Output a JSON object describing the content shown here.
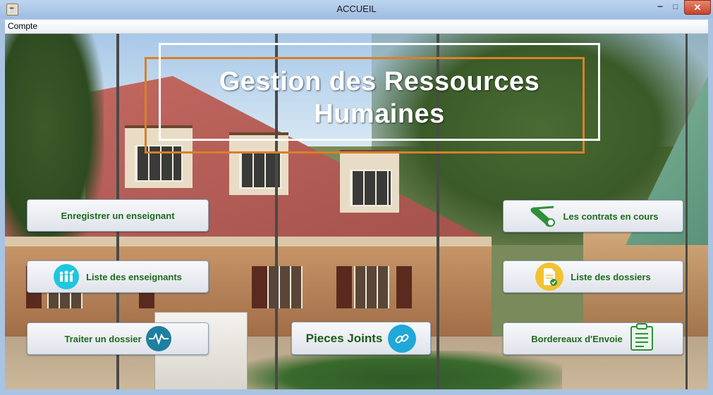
{
  "window": {
    "title": "ACCUEIL"
  },
  "menu": {
    "items": [
      "Compte"
    ]
  },
  "main": {
    "headline_line1": "Gestion des Ressources",
    "headline_line2": "Humaines"
  },
  "buttons": {
    "enregistrer": "Enregistrer un enseignant",
    "liste_enseignants": "Liste des enseignants",
    "traiter_dossier": "Traiter un dossier",
    "pieces_jointes": "Pieces Joints",
    "contrats": "Les contrats en cours",
    "liste_dossiers": "Liste des dossiers",
    "bordereaux": "Bordereaux d'Envoie"
  },
  "colors": {
    "accent_orange": "#d9802a",
    "label_green": "#1e6b1e",
    "icon_cyan": "#1fc6e0",
    "icon_teal": "#1e7fa0",
    "icon_yellow": "#f2c232",
    "icon_green": "#2f8f3a"
  },
  "icons": [
    "java-app-icon",
    "teachers-icon",
    "heartbeat-icon",
    "link-icon",
    "contract-scroll-icon",
    "document-check-icon",
    "clipboard-icon"
  ]
}
